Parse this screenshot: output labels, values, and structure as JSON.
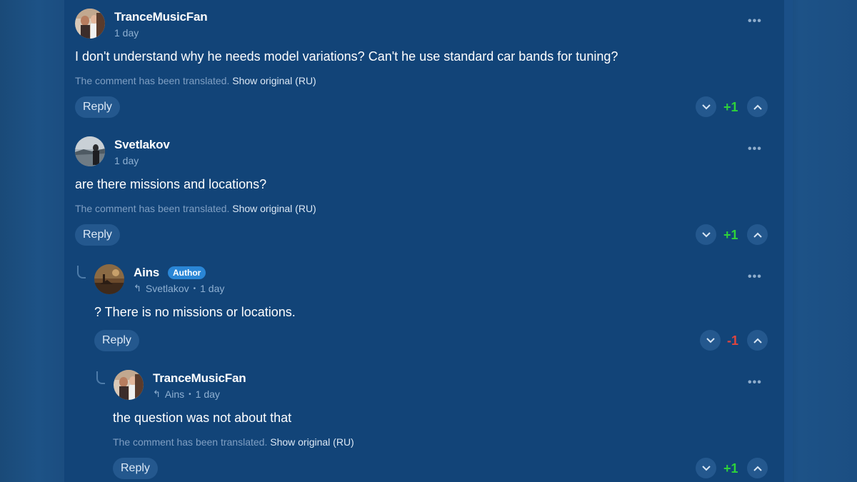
{
  "colors": {
    "positive": "#2ed33a",
    "negative": "#e0453e",
    "author_badge": "#2a86d6"
  },
  "comments": [
    {
      "username": "TranceMusicFan",
      "time": "1 day",
      "text": "I don't understand why he needs model variations? Can't he use standard car bands for tuning?",
      "translated_note": "The comment has been translated.",
      "show_original": "Show original (RU)",
      "reply_label": "Reply",
      "score": "+1"
    },
    {
      "username": "Svetlakov",
      "time": "1 day",
      "text": "are there missions and locations?",
      "translated_note": "The comment has been translated.",
      "show_original": "Show original (RU)",
      "reply_label": "Reply",
      "score": "+1"
    },
    {
      "username": "Ains",
      "badge": "Author",
      "reply_to": "Svetlakov",
      "time": "1 day",
      "text": "? There is no missions or locations.",
      "reply_label": "Reply",
      "score": "-1"
    },
    {
      "username": "TranceMusicFan",
      "reply_to": "Ains",
      "time": "1 day",
      "text": "the question was not about that",
      "translated_note": "The comment has been translated.",
      "show_original": "Show original (RU)",
      "reply_label": "Reply",
      "score": "+1"
    }
  ],
  "icons": {
    "more": "more-options-icon",
    "downvote": "chevron-down-icon",
    "upvote": "chevron-up-icon",
    "reply_arrow": "reply-arrow-icon"
  },
  "glyphs": {
    "more": "•••",
    "reply_arrow": "↰",
    "dot": "•"
  }
}
